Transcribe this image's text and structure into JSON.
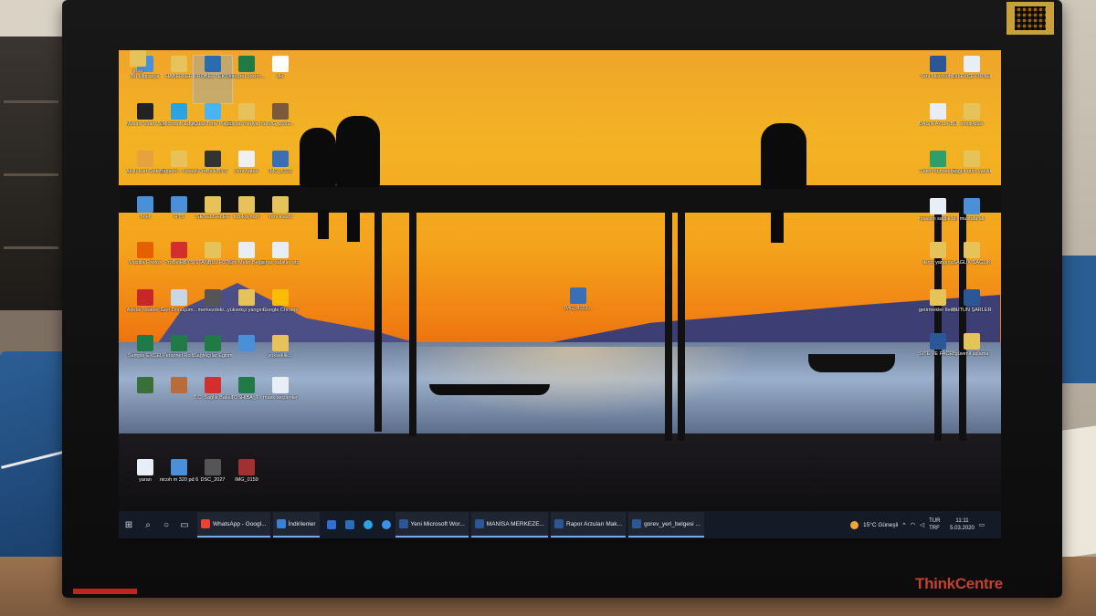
{
  "monitor": {
    "brand": "ThinkCentre"
  },
  "desktop_icons": [
    {
      "label": "Bu bilgisayar",
      "color": "#4a90d9"
    },
    {
      "label": "HABERLER",
      "color": "#e6c35a"
    },
    {
      "label": "PROBEL TEKSTİL Bilgisi",
      "color": "#2b6cb0",
      "selected": true
    },
    {
      "label": "fotoğraf çekim...",
      "color": "#1f7a45"
    },
    {
      "label": "dkr",
      "color": "#ffffff"
    },
    {
      "label": "Movavi Video Suite 22",
      "color": "#222222"
    },
    {
      "label": "Microsoft Edge",
      "color": "#2ca3e0"
    },
    {
      "label": "QuickTime Player",
      "color": "#4ab3f4"
    },
    {
      "label": "sosyal medya man bas...",
      "color": "#e6c35a"
    },
    {
      "label": "IMG_2099...",
      "color": "#7a5a3a"
    },
    {
      "label": "Akıllı Kart Sistemi Arayüzü",
      "color": "#e6a23c"
    },
    {
      "label": "Belgeler - Kısayol",
      "color": "#e6c35a"
    },
    {
      "label": "ProBelHBYS",
      "color": "#333333"
    },
    {
      "label": "yeni-haber",
      "color": "#f0f0f0"
    },
    {
      "label": "IMG_8322",
      "color": "#3a6fb5"
    },
    {
      "label": "brief",
      "color": "#4a90d9"
    },
    {
      "label": "HTS",
      "color": "#4a90d9"
    },
    {
      "label": "GENELGELER",
      "color": "#e6c35a"
    },
    {
      "label": "top-kaynam",
      "color": "#e6c35a"
    },
    {
      "label": "Yeni klasör",
      "color": "#e6c35a"
    },
    {
      "label": "Mozilla Firefox",
      "color": "#e66000"
    },
    {
      "label": "ProBelHBYS",
      "color": "#d32f2f"
    },
    {
      "label": "İSTANBUL FOTOĞRAF...",
      "color": "#e6c35a"
    },
    {
      "label": "Yeni Metin Belgesi",
      "color": "#e8eef6"
    },
    {
      "label": "sınav sabitler stü",
      "color": "#e8eef6"
    },
    {
      "label": "Adobe Reader X",
      "color": "#c62828"
    },
    {
      "label": "Geri Dönüşüm...",
      "color": "#c9d6e6"
    },
    {
      "label": "merkezdeki...",
      "color": "#555555"
    },
    {
      "label": "yüksekçi yangınışı",
      "color": "#e6c35a"
    },
    {
      "label": "Google Chrome",
      "color": "#fbbc05"
    },
    {
      "label": "Sample EXCEL",
      "color": "#1f7a45"
    },
    {
      "label": "Personel Rollu",
      "color": "#1f7a45"
    },
    {
      "label": "Sağlıkçılar Egitim Sunu...",
      "color": "#1f7a45"
    },
    {
      "label": "",
      "color": "#4a90d9"
    },
    {
      "label": "yükseklik...",
      "color": "#e6c35a"
    },
    {
      "label": "",
      "color": "#3a6f3a"
    },
    {
      "label": "",
      "color": "#b96c3a"
    },
    {
      "label": "T.C. Sağlık Bakanlığı...",
      "color": "#d32f2f"
    },
    {
      "label": "TOSHIBA_T...",
      "color": "#1f7a45"
    },
    {
      "label": "mask seçilenler",
      "color": "#e8eef6"
    },
    {
      "label": "yaran",
      "color": "#e8eef6"
    },
    {
      "label": "nicoh m 320 pd 6 (10.1...",
      "color": "#4a90d9"
    },
    {
      "label": "DSC_2027",
      "color": "#555555"
    },
    {
      "label": "IMG_0159",
      "color": "#a33030"
    },
    {
      "label": "IMG_8022...",
      "color": "#3a6fb5"
    },
    {
      "label": "Yeni Microsoft...",
      "color": "#2b5797"
    },
    {
      "label": "DİLEKÇE ÖRNEKLERİ",
      "color": "#e8eef6"
    },
    {
      "label": "BASIN AYLIK BÜNDFİ...",
      "color": "#e8eef6"
    },
    {
      "label": "emoji-güle",
      "color": "#e6c35a"
    },
    {
      "label": "Fatih muhasebe",
      "color": "#2e9e6a"
    },
    {
      "label": "sağlık atıcı yazıldığı...",
      "color": "#e6c35a"
    },
    {
      "label": "mavisin sağlık bildiriği bel...",
      "color": "#e8eef6"
    },
    {
      "label": "mustafa ali",
      "color": "#4a90d9"
    },
    {
      "label": "ikinci yangına",
      "color": "#e6c35a"
    },
    {
      "label": "SAĞLIK SAĞLIK",
      "color": "#e6c35a"
    },
    {
      "label": "getirmekler İletişim-2020",
      "color": "#e6c35a"
    },
    {
      "label": "BÜTÜN ŞARLER HA...",
      "color": "#2b5797"
    },
    {
      "label": "SİTE VE FACEBOO...",
      "color": "#2b5797"
    },
    {
      "label": "güvenli aşlama",
      "color": "#e6c35a"
    },
    {
      "label": "grup",
      "color": "#e6c35a"
    }
  ],
  "taskbar": {
    "start_icon": "windows-icon",
    "apps": [
      {
        "label": "WhatsApp - Googl...",
        "color": "#ea4335"
      },
      {
        "label": "İndirilenler",
        "color": "#3a7fd8"
      },
      {
        "label": "Yeni Microsoft Wor...",
        "color": "#2b5797"
      },
      {
        "label": "MANİSA MERKEZE...",
        "color": "#2b5797"
      },
      {
        "label": "Rapor Arzuları Mak...",
        "color": "#2b5797"
      },
      {
        "label": "gorev_yeri_belgesi ...",
        "color": "#2b5797"
      }
    ],
    "weather": "15°C Güneşli",
    "language": "TUR TRF",
    "time": "11:11",
    "date": "5.03.2020"
  }
}
